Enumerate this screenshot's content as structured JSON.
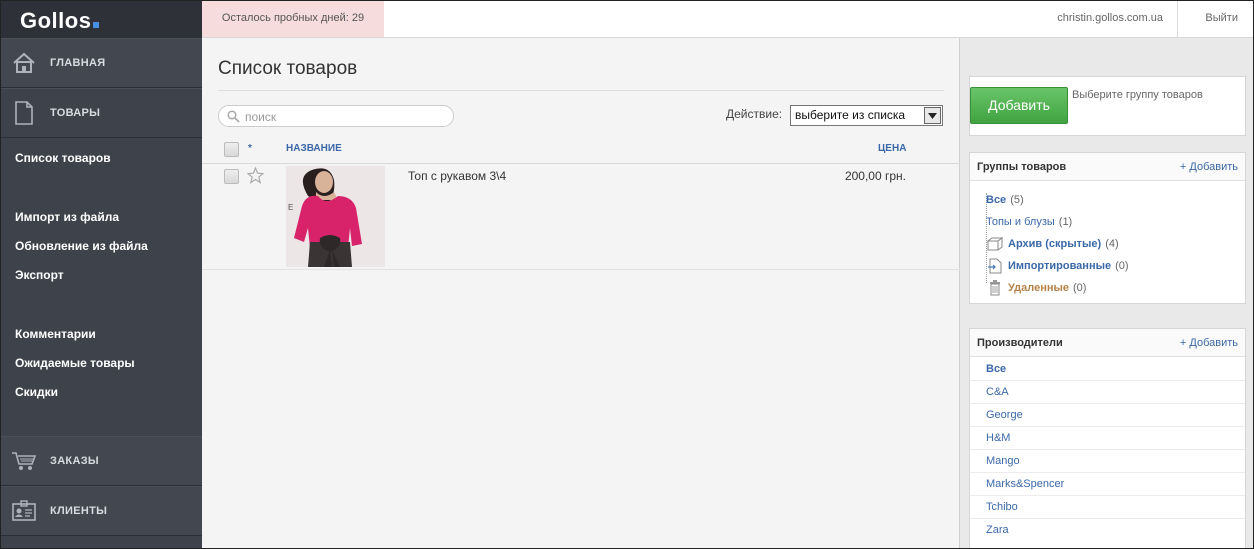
{
  "app": {
    "logo": "Gollos"
  },
  "sidebar": {
    "main": {
      "label": "ГЛАВНАЯ",
      "icon": "home-icon"
    },
    "products": {
      "label": "ТОВАРЫ",
      "icon": "document-icon"
    },
    "sub_items": [
      {
        "label": "Список товаров"
      },
      {
        "label": "Импорт из файла"
      },
      {
        "label": "Обновление из файла"
      },
      {
        "label": "Экспорт"
      },
      {
        "label": "Комментарии"
      },
      {
        "label": "Ожидаемые товары"
      },
      {
        "label": "Скидки"
      }
    ],
    "orders": {
      "label": "ЗАКАЗЫ",
      "icon": "cart-icon"
    },
    "clients": {
      "label": "КЛИЕНТЫ",
      "icon": "id-card-icon"
    }
  },
  "topbar": {
    "trial": "Осталось пробных дней: 29",
    "account": "christin.gollos.com.ua",
    "logout": "Выйти"
  },
  "main": {
    "title": "Список товаров",
    "search_placeholder": "поиск",
    "action_label": "Действие:",
    "action_selected": "выберите из списка",
    "columns": {
      "star": "*",
      "name": "НАЗВАНИЕ",
      "price": "ЦЕНА"
    },
    "rows": [
      {
        "name": "Топ с рукавом 3\\4",
        "price": "200,00 грн."
      }
    ]
  },
  "right": {
    "add_button": "Добавить",
    "add_hint": "Выберите группу товаров",
    "groups": {
      "title": "Группы товаров",
      "add": "+ Добавить",
      "items": [
        {
          "label": "Все",
          "count": "(5)"
        },
        {
          "label": "Топы и блузы",
          "count": "(1)"
        },
        {
          "label": "Архив (скрытые)",
          "count": "(4)"
        },
        {
          "label": "Импортированные",
          "count": "(0)"
        },
        {
          "label": "Удаленные",
          "count": "(0)"
        }
      ]
    },
    "makers": {
      "title": "Производители",
      "add": "+ Добавить",
      "items": [
        "Все",
        "C&A",
        "George",
        "H&M",
        "Mango",
        "Marks&Spencer",
        "Tchibo",
        "Zara"
      ]
    }
  },
  "colors": {
    "accent_blue": "#3b68a8",
    "green_button": "#4caf50",
    "trial_bg": "#f6dcdc",
    "sidebar_bg": "#3e424a",
    "deleted_orange": "#b5834a"
  }
}
